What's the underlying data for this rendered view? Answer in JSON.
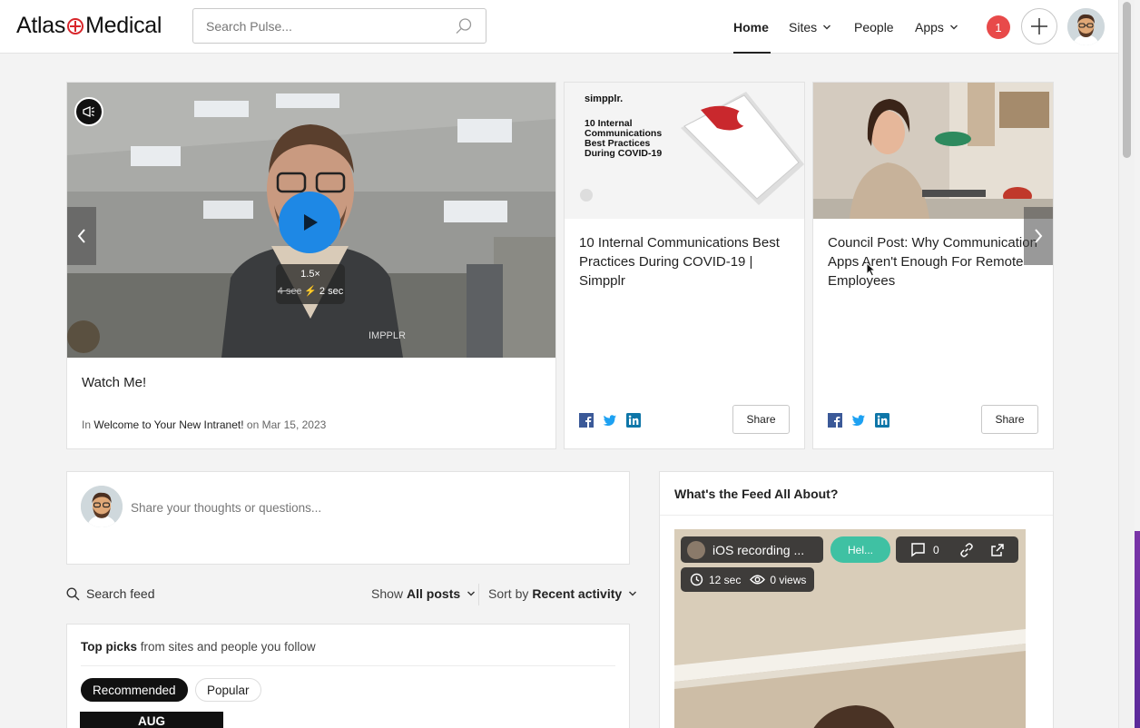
{
  "header": {
    "logo_text_left": "Atlas",
    "logo_text_right": "Medical",
    "search_placeholder": "Search Pulse...",
    "nav": {
      "home": "Home",
      "sites": "Sites",
      "people": "People",
      "apps": "Apps"
    },
    "notification_count": "1"
  },
  "carousel": {
    "video_card": {
      "title": "Watch Me!",
      "meta_prefix": "In",
      "meta_site": "Welcome to Your New Intranet!",
      "meta_on": "on",
      "meta_date": "Mar 15, 2023",
      "speed_label": "1.5×",
      "time_old": "4 sec",
      "time_new": "2 sec"
    },
    "article_a": {
      "brand": "simpplr.",
      "thumb_text": "10 Internal Communications Best Practices During COVID-19",
      "title": "10 Internal Communications Best Practices During COVID-19 | Simpplr",
      "share_label": "Share"
    },
    "article_b": {
      "title": "Council Post: Why Communication Apps Aren't Enough For Remote Employees",
      "share_label": "Share"
    }
  },
  "composer": {
    "placeholder": "Share your thoughts or questions..."
  },
  "feed_controls": {
    "search_label": "Search feed",
    "show_prefix": "Show",
    "show_value": "All posts",
    "sort_prefix": "Sort by",
    "sort_value": "Recent activity"
  },
  "top_picks": {
    "title_bold": "Top picks",
    "title_rest": "from sites and people you follow",
    "pill_recommended": "Recommended",
    "pill_popular": "Popular",
    "date_month": "AUG"
  },
  "feed_about": {
    "title": "What's the Feed All About?",
    "video_title": "iOS recording ...",
    "tag": "Hel...",
    "comments": "0",
    "duration": "12 sec",
    "views": "0 views"
  },
  "colors": {
    "notification": "#e84a4a",
    "logo_cross": "#d8262b",
    "play": "#1e88e5",
    "tag": "#3fc1a3"
  }
}
